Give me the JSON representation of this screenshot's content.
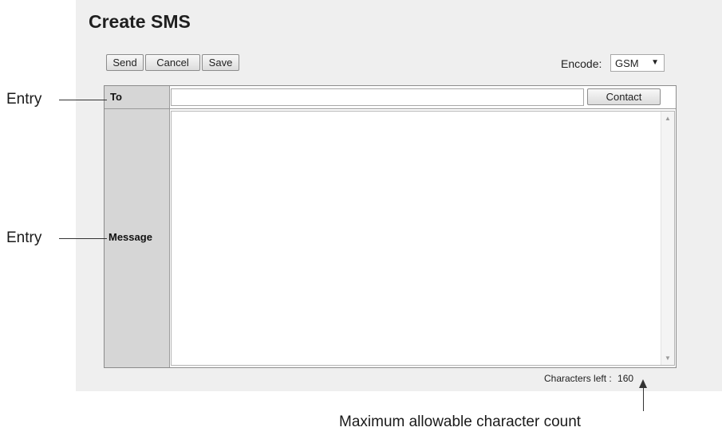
{
  "window": {
    "title": "Create SMS"
  },
  "toolbar": {
    "send_label": "Send",
    "cancel_label": "Cancel",
    "save_label": "Save"
  },
  "encode": {
    "label": "Encode:",
    "selected": "GSM"
  },
  "form": {
    "to_label": "To",
    "to_value": "",
    "contact_label": "Contact",
    "message_label": "Message",
    "message_value": ""
  },
  "status": {
    "chars_left_label": "Characters left :",
    "chars_left_value": "160"
  },
  "annotations": {
    "entry_to": "Entry",
    "entry_message": "Entry",
    "max_count": "Maximum allowable character count"
  },
  "colors": {
    "panel_bg": "#efefef",
    "label_col_bg": "#d6d6d6"
  }
}
